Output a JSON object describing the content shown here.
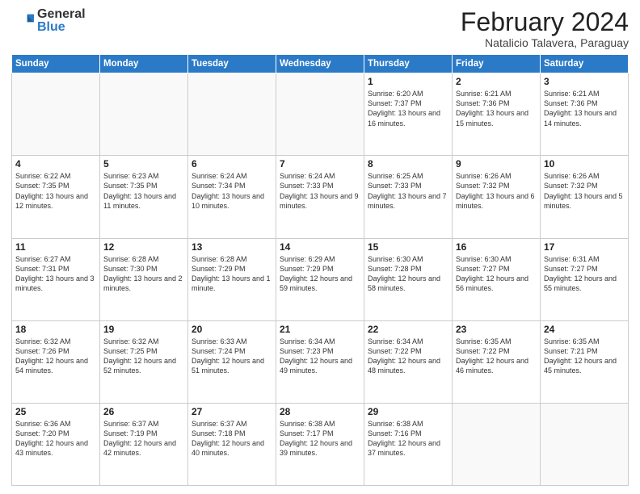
{
  "logo": {
    "general": "General",
    "blue": "Blue"
  },
  "header": {
    "month": "February 2024",
    "location": "Natalicio Talavera, Paraguay"
  },
  "weekdays": [
    "Sunday",
    "Monday",
    "Tuesday",
    "Wednesday",
    "Thursday",
    "Friday",
    "Saturday"
  ],
  "weeks": [
    [
      {
        "day": "",
        "info": ""
      },
      {
        "day": "",
        "info": ""
      },
      {
        "day": "",
        "info": ""
      },
      {
        "day": "",
        "info": ""
      },
      {
        "day": "1",
        "info": "Sunrise: 6:20 AM\nSunset: 7:37 PM\nDaylight: 13 hours\nand 16 minutes."
      },
      {
        "day": "2",
        "info": "Sunrise: 6:21 AM\nSunset: 7:36 PM\nDaylight: 13 hours\nand 15 minutes."
      },
      {
        "day": "3",
        "info": "Sunrise: 6:21 AM\nSunset: 7:36 PM\nDaylight: 13 hours\nand 14 minutes."
      }
    ],
    [
      {
        "day": "4",
        "info": "Sunrise: 6:22 AM\nSunset: 7:35 PM\nDaylight: 13 hours\nand 12 minutes."
      },
      {
        "day": "5",
        "info": "Sunrise: 6:23 AM\nSunset: 7:35 PM\nDaylight: 13 hours\nand 11 minutes."
      },
      {
        "day": "6",
        "info": "Sunrise: 6:24 AM\nSunset: 7:34 PM\nDaylight: 13 hours\nand 10 minutes."
      },
      {
        "day": "7",
        "info": "Sunrise: 6:24 AM\nSunset: 7:33 PM\nDaylight: 13 hours\nand 9 minutes."
      },
      {
        "day": "8",
        "info": "Sunrise: 6:25 AM\nSunset: 7:33 PM\nDaylight: 13 hours\nand 7 minutes."
      },
      {
        "day": "9",
        "info": "Sunrise: 6:26 AM\nSunset: 7:32 PM\nDaylight: 13 hours\nand 6 minutes."
      },
      {
        "day": "10",
        "info": "Sunrise: 6:26 AM\nSunset: 7:32 PM\nDaylight: 13 hours\nand 5 minutes."
      }
    ],
    [
      {
        "day": "11",
        "info": "Sunrise: 6:27 AM\nSunset: 7:31 PM\nDaylight: 13 hours\nand 3 minutes."
      },
      {
        "day": "12",
        "info": "Sunrise: 6:28 AM\nSunset: 7:30 PM\nDaylight: 13 hours\nand 2 minutes."
      },
      {
        "day": "13",
        "info": "Sunrise: 6:28 AM\nSunset: 7:29 PM\nDaylight: 13 hours\nand 1 minute."
      },
      {
        "day": "14",
        "info": "Sunrise: 6:29 AM\nSunset: 7:29 PM\nDaylight: 12 hours\nand 59 minutes."
      },
      {
        "day": "15",
        "info": "Sunrise: 6:30 AM\nSunset: 7:28 PM\nDaylight: 12 hours\nand 58 minutes."
      },
      {
        "day": "16",
        "info": "Sunrise: 6:30 AM\nSunset: 7:27 PM\nDaylight: 12 hours\nand 56 minutes."
      },
      {
        "day": "17",
        "info": "Sunrise: 6:31 AM\nSunset: 7:27 PM\nDaylight: 12 hours\nand 55 minutes."
      }
    ],
    [
      {
        "day": "18",
        "info": "Sunrise: 6:32 AM\nSunset: 7:26 PM\nDaylight: 12 hours\nand 54 minutes."
      },
      {
        "day": "19",
        "info": "Sunrise: 6:32 AM\nSunset: 7:25 PM\nDaylight: 12 hours\nand 52 minutes."
      },
      {
        "day": "20",
        "info": "Sunrise: 6:33 AM\nSunset: 7:24 PM\nDaylight: 12 hours\nand 51 minutes."
      },
      {
        "day": "21",
        "info": "Sunrise: 6:34 AM\nSunset: 7:23 PM\nDaylight: 12 hours\nand 49 minutes."
      },
      {
        "day": "22",
        "info": "Sunrise: 6:34 AM\nSunset: 7:22 PM\nDaylight: 12 hours\nand 48 minutes."
      },
      {
        "day": "23",
        "info": "Sunrise: 6:35 AM\nSunset: 7:22 PM\nDaylight: 12 hours\nand 46 minutes."
      },
      {
        "day": "24",
        "info": "Sunrise: 6:35 AM\nSunset: 7:21 PM\nDaylight: 12 hours\nand 45 minutes."
      }
    ],
    [
      {
        "day": "25",
        "info": "Sunrise: 6:36 AM\nSunset: 7:20 PM\nDaylight: 12 hours\nand 43 minutes."
      },
      {
        "day": "26",
        "info": "Sunrise: 6:37 AM\nSunset: 7:19 PM\nDaylight: 12 hours\nand 42 minutes."
      },
      {
        "day": "27",
        "info": "Sunrise: 6:37 AM\nSunset: 7:18 PM\nDaylight: 12 hours\nand 40 minutes."
      },
      {
        "day": "28",
        "info": "Sunrise: 6:38 AM\nSunset: 7:17 PM\nDaylight: 12 hours\nand 39 minutes."
      },
      {
        "day": "29",
        "info": "Sunrise: 6:38 AM\nSunset: 7:16 PM\nDaylight: 12 hours\nand 37 minutes."
      },
      {
        "day": "",
        "info": ""
      },
      {
        "day": "",
        "info": ""
      }
    ]
  ]
}
